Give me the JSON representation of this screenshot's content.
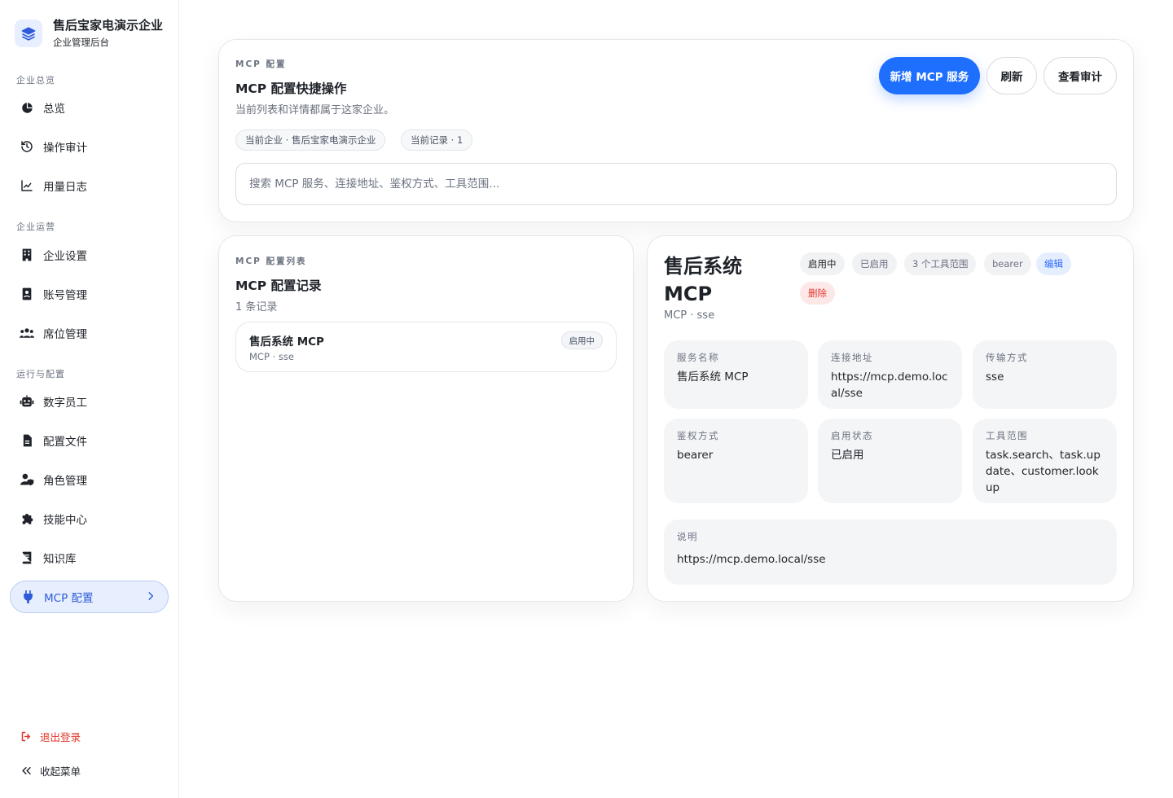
{
  "brand": {
    "name": "售后宝家电演示企业",
    "subtitle": "企业管理后台"
  },
  "sidebar": {
    "sections": [
      {
        "title": "企业总览"
      },
      {
        "title": "企业运营"
      },
      {
        "title": "运行与配置"
      }
    ],
    "items": [
      {
        "label": "总览",
        "icon": "pie-chart-icon"
      },
      {
        "label": "操作审计",
        "icon": "history-icon"
      },
      {
        "label": "用量日志",
        "icon": "line-chart-icon"
      },
      {
        "label": "企业设置",
        "icon": "building-icon"
      },
      {
        "label": "账号管理",
        "icon": "id-card-icon"
      },
      {
        "label": "席位管理",
        "icon": "users-icon"
      },
      {
        "label": "数字员工",
        "icon": "robot-icon"
      },
      {
        "label": "配置文件",
        "icon": "file-icon"
      },
      {
        "label": "角色管理",
        "icon": "user-shield-icon"
      },
      {
        "label": "技能中心",
        "icon": "puzzle-icon"
      },
      {
        "label": "知识库",
        "icon": "book-icon"
      },
      {
        "label": "MCP 配置",
        "icon": "plug-icon",
        "active": true
      }
    ],
    "logout": "退出登录",
    "collapse": "收起菜单"
  },
  "top": {
    "eyebrow": "MCP 配置",
    "title": "MCP 配置快捷操作",
    "desc": "当前列表和详情都属于这家企业。",
    "chip_company": "当前企业 · 售后宝家电演示企业",
    "chip_count": "当前记录 · 1",
    "search_placeholder": "搜索 MCP 服务、连接地址、鉴权方式、工具范围...",
    "btn_add": "新增 MCP 服务",
    "btn_refresh": "刷新",
    "btn_audit": "查看审计"
  },
  "list": {
    "eyebrow": "MCP 配置列表",
    "title": "MCP 配置记录",
    "count": "1 条记录",
    "rows": [
      {
        "name": "售后系统 MCP",
        "meta": "MCP · sse",
        "badge": "启用中"
      }
    ]
  },
  "detail": {
    "title": "售后系统 MCP",
    "subtitle": "MCP · sse",
    "tags": [
      "启用中",
      "已启用",
      "3 个工具范围",
      "bearer"
    ],
    "edit": "编辑",
    "delete": "删除",
    "fields": [
      {
        "label": "服务名称",
        "value": "售后系统 MCP"
      },
      {
        "label": "连接地址",
        "value": "https://mcp.demo.local/sse"
      },
      {
        "label": "传输方式",
        "value": "sse"
      },
      {
        "label": "鉴权方式",
        "value": "bearer"
      },
      {
        "label": "启用状态",
        "value": "已启用"
      },
      {
        "label": "工具范围",
        "value": "task.search、task.update、customer.lookup"
      }
    ],
    "desc_label": "说明",
    "desc_value": "https://mcp.demo.local/sse"
  },
  "colors": {
    "accent": "#1f6fff",
    "danger": "#e0372c",
    "active_bg": "#e7efff"
  }
}
